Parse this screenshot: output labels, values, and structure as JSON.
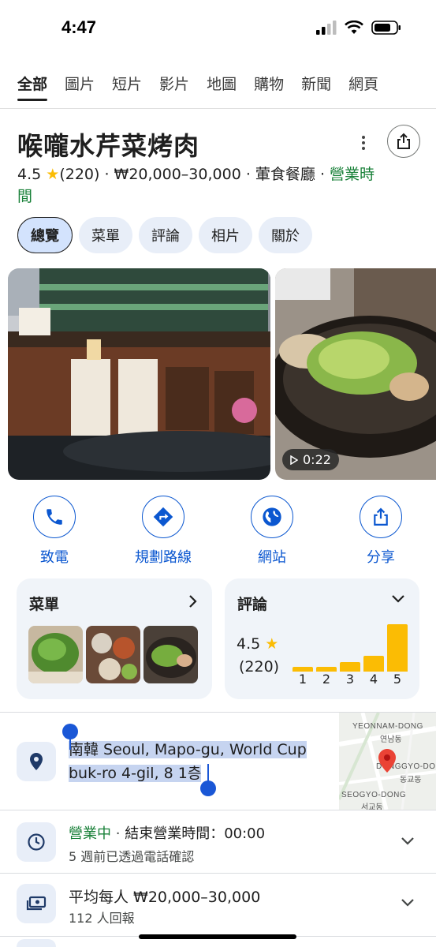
{
  "status_bar": {
    "time": "4:47"
  },
  "tabs": [
    {
      "label": "全部",
      "active": true
    },
    {
      "label": "圖片"
    },
    {
      "label": "短片"
    },
    {
      "label": "影片"
    },
    {
      "label": "地圖"
    },
    {
      "label": "購物"
    },
    {
      "label": "新聞"
    },
    {
      "label": "網頁"
    }
  ],
  "place": {
    "name": "喉嚨水芹菜烤肉",
    "rating": "4.5",
    "review_count": "(220)",
    "price": "₩20,000–30,000",
    "category": "葷食餐廳",
    "status": "營業時間"
  },
  "chips": [
    "總覽",
    "菜單",
    "評論",
    "相片",
    "關於"
  ],
  "video_duration": "0:22",
  "actions": [
    {
      "label": "致電",
      "icon": "phone-icon"
    },
    {
      "label": "規劃路線",
      "icon": "directions-icon"
    },
    {
      "label": "網站",
      "icon": "globe-icon"
    },
    {
      "label": "分享",
      "icon": "share-icon"
    }
  ],
  "menu_card": {
    "title": "菜單"
  },
  "reviews_card": {
    "title": "評論",
    "rating": "4.5",
    "count": "(220)",
    "distribution": [
      {
        "stars": "1",
        "fraction": 0.1
      },
      {
        "stars": "2",
        "fraction": 0.1
      },
      {
        "stars": "3",
        "fraction": 0.2
      },
      {
        "stars": "4",
        "fraction": 0.34
      },
      {
        "stars": "5",
        "fraction": 1.0
      }
    ]
  },
  "address": {
    "text": "南韓 Seoul, Mapo-gu, World Cup buk-ro 4-gil, 8 1층",
    "map_labels": [
      "YEONNAM-DONG",
      "연남동",
      "DONGGYO-DO",
      "동교동",
      "SEOGYO-DONG",
      "서교동"
    ]
  },
  "hours": {
    "status": "營業中",
    "separator": "·",
    "closing": "結束營業時間：00:00",
    "note": "5 週前已透過電話確認"
  },
  "price_row": {
    "label": "平均每人 ₩20,000–30,000",
    "note": "112 人回報"
  },
  "colors": {
    "accent_blue": "#0b57d0",
    "star_yellow": "#fbbc04",
    "open_green": "#188038",
    "selection": "#c6d4f0"
  }
}
